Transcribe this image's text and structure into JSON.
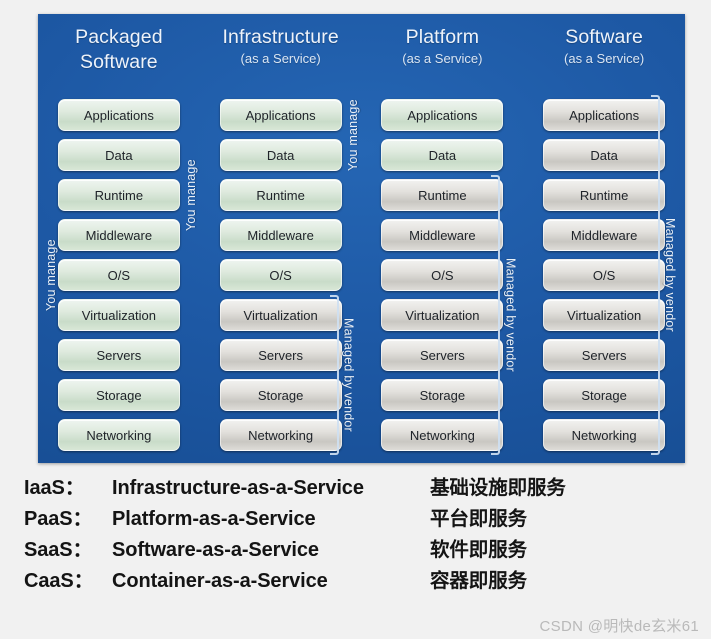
{
  "panel": {
    "background_color": "#1d58a4",
    "columns": [
      {
        "title": "Packaged\nSoftware",
        "subtitle": "",
        "left_label": "You manage",
        "right_label": "",
        "boxes": [
          {
            "label": "Applications",
            "managed": "user"
          },
          {
            "label": "Data",
            "managed": "user"
          },
          {
            "label": "Runtime",
            "managed": "user"
          },
          {
            "label": "Middleware",
            "managed": "user"
          },
          {
            "label": "O/S",
            "managed": "user"
          },
          {
            "label": "Virtualization",
            "managed": "user"
          },
          {
            "label": "Servers",
            "managed": "user"
          },
          {
            "label": "Storage",
            "managed": "user"
          },
          {
            "label": "Networking",
            "managed": "user"
          }
        ]
      },
      {
        "title": "Infrastructure",
        "subtitle": "(as a Service)",
        "left_label": "You manage",
        "right_label": "Managed by vendor",
        "boxes": [
          {
            "label": "Applications",
            "managed": "user"
          },
          {
            "label": "Data",
            "managed": "user"
          },
          {
            "label": "Runtime",
            "managed": "user"
          },
          {
            "label": "Middleware",
            "managed": "user"
          },
          {
            "label": "O/S",
            "managed": "user"
          },
          {
            "label": "Virtualization",
            "managed": "vendor"
          },
          {
            "label": "Servers",
            "managed": "vendor"
          },
          {
            "label": "Storage",
            "managed": "vendor"
          },
          {
            "label": "Networking",
            "managed": "vendor"
          }
        ]
      },
      {
        "title": "Platform",
        "subtitle": "(as a Service)",
        "left_label": "You manage",
        "right_label": "Managed by vendor",
        "boxes": [
          {
            "label": "Applications",
            "managed": "user"
          },
          {
            "label": "Data",
            "managed": "user"
          },
          {
            "label": "Runtime",
            "managed": "vendor"
          },
          {
            "label": "Middleware",
            "managed": "vendor"
          },
          {
            "label": "O/S",
            "managed": "vendor"
          },
          {
            "label": "Virtualization",
            "managed": "vendor"
          },
          {
            "label": "Servers",
            "managed": "vendor"
          },
          {
            "label": "Storage",
            "managed": "vendor"
          },
          {
            "label": "Networking",
            "managed": "vendor"
          }
        ]
      },
      {
        "title": "Software",
        "subtitle": "(as a Service)",
        "left_label": "",
        "right_label": "Managed by vendor",
        "boxes": [
          {
            "label": "Applications",
            "managed": "vendor"
          },
          {
            "label": "Data",
            "managed": "vendor"
          },
          {
            "label": "Runtime",
            "managed": "vendor"
          },
          {
            "label": "Middleware",
            "managed": "vendor"
          },
          {
            "label": "O/S",
            "managed": "vendor"
          },
          {
            "label": "Virtualization",
            "managed": "vendor"
          },
          {
            "label": "Servers",
            "managed": "vendor"
          },
          {
            "label": "Storage",
            "managed": "vendor"
          },
          {
            "label": "Networking",
            "managed": "vendor"
          }
        ]
      }
    ]
  },
  "legend": {
    "rows": [
      {
        "abbr": "IaaS：",
        "english": "Infrastructure-as-a-Service",
        "chinese": "基础设施即服务"
      },
      {
        "abbr": "PaaS：",
        "english": "Platform-as-a-Service",
        "chinese": "平台即服务"
      },
      {
        "abbr": "SaaS：",
        "english": "Software-as-a-Service",
        "chinese": "软件即服务"
      },
      {
        "abbr": "CaaS：",
        "english": "Container-as-a-Service",
        "chinese": "容器即服务"
      }
    ]
  },
  "watermark": {
    "text": "CSDN @明快de玄米61"
  }
}
